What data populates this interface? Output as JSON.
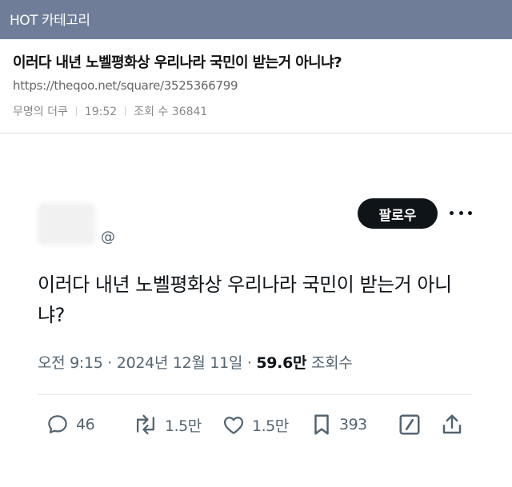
{
  "topbar": {
    "label": "HOT 카테고리"
  },
  "post": {
    "title": "이러다 내년 노벨평화상 우리나라 국민이 받는거 아니냐?",
    "url": "https://theqoo.net/square/3525366799",
    "author": "무명의 더쿠",
    "time": "19:52",
    "views_label": "조회 수 36841"
  },
  "tweet": {
    "handle": "@",
    "follow_label": "팔로우",
    "text": "이러다 내년 노벨평화상 우리나라 국민이 받는거 아니냐?",
    "timestamp": "오전 9:15 · 2024년 12월 11일 · ",
    "views_value": "59.6만",
    "views_suffix": " 조회수"
  },
  "actions": {
    "replies": "46",
    "retweets": "1.5만",
    "likes": "1.5만",
    "bookmarks": "393"
  },
  "icons": [
    "reply-icon",
    "retweet-icon",
    "like-icon",
    "bookmark-icon",
    "edit-icon",
    "share-icon",
    "more-icon"
  ]
}
